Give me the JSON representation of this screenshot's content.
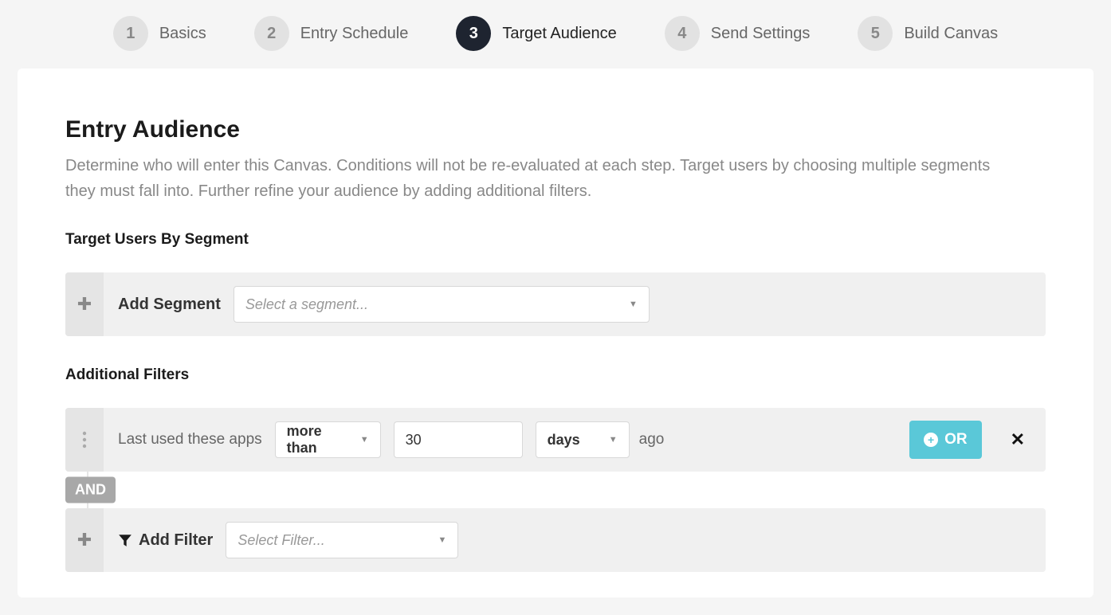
{
  "wizard": {
    "steps": [
      {
        "num": "1",
        "label": "Basics"
      },
      {
        "num": "2",
        "label": "Entry Schedule"
      },
      {
        "num": "3",
        "label": "Target Audience"
      },
      {
        "num": "4",
        "label": "Send Settings"
      },
      {
        "num": "5",
        "label": "Build Canvas"
      }
    ]
  },
  "page": {
    "title": "Entry Audience",
    "description": "Determine who will enter this Canvas. Conditions will not be re-evaluated at each step. Target users by choosing multiple segments they must fall into. Further refine your audience by adding additional filters."
  },
  "segments": {
    "heading": "Target Users By Segment",
    "add_label": "Add Segment",
    "placeholder": "Select a segment..."
  },
  "filters": {
    "heading": "Additional Filters",
    "row1_label": "Last used these apps",
    "comparator": "more than",
    "value": "30",
    "unit": "days",
    "suffix": "ago",
    "or_label": "OR",
    "and_label": "AND",
    "add_filter_label": "Add Filter",
    "select_filter_placeholder": "Select Filter..."
  }
}
